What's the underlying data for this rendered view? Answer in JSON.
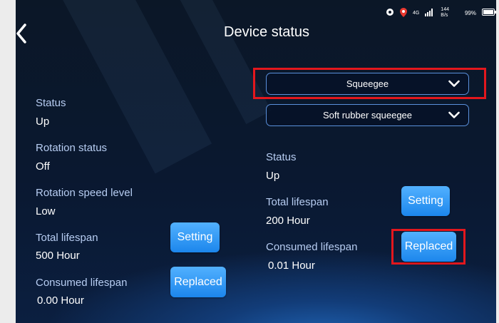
{
  "header": {
    "title": "Device status"
  },
  "status_bar": {
    "net_label": "4G",
    "speed_value": "144",
    "speed_unit": "B/s",
    "battery": "99%"
  },
  "left_panel": {
    "fields": [
      {
        "label": "Status",
        "value": "Up"
      },
      {
        "label": "Rotation status",
        "value": "Off"
      },
      {
        "label": "Rotation speed level",
        "value": "Low"
      },
      {
        "label": "Total lifespan",
        "value": "500 Hour"
      },
      {
        "label": "Consumed lifespan",
        "value": "0.00 Hour"
      }
    ],
    "setting_label": "Setting",
    "replaced_label": "Replaced"
  },
  "right_panel": {
    "select_component": "Squeegee",
    "select_type": "Soft rubber squeegee",
    "fields": [
      {
        "label": "Status",
        "value": "Up"
      },
      {
        "label": "Total lifespan",
        "value": "200 Hour"
      },
      {
        "label": "Consumed lifespan",
        "value": "0.01 Hour"
      }
    ],
    "setting_label": "Setting",
    "replaced_label": "Replaced"
  },
  "colors": {
    "accent": "#2a93f5",
    "highlight": "#e3171d",
    "label": "#b7cdf2"
  },
  "icons": [
    "back-icon",
    "media-icon",
    "location-pin-icon",
    "signal-icon",
    "battery-icon",
    "chevron-down-icon"
  ]
}
